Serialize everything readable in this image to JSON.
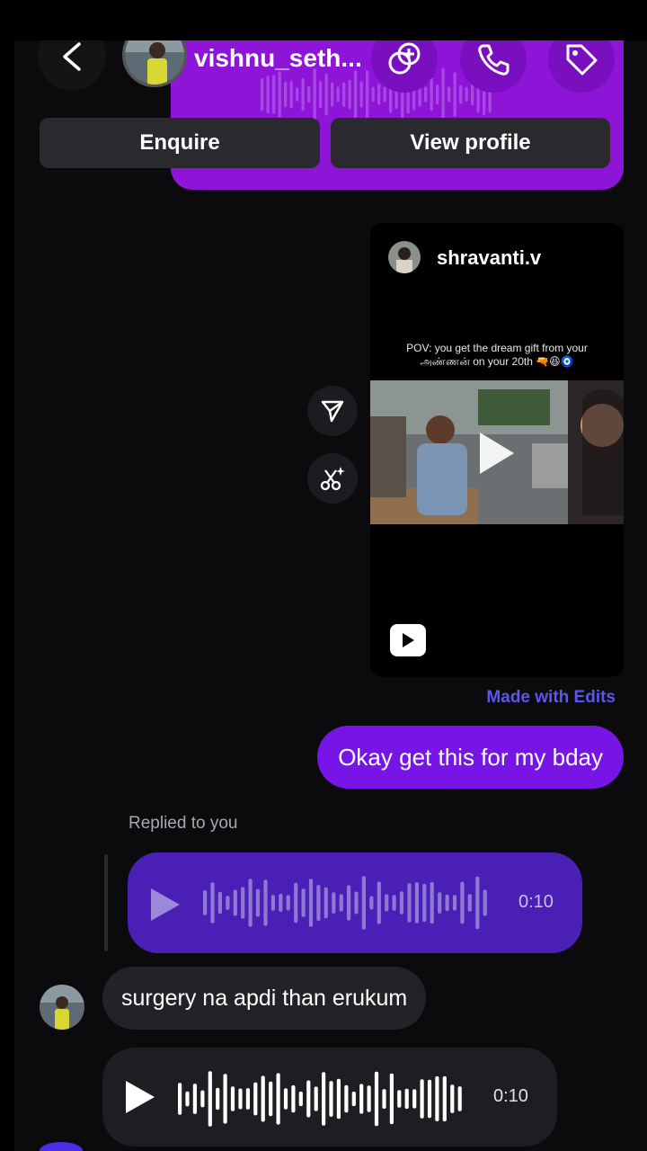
{
  "header": {
    "username": "vishnu_seth...",
    "enquire_label": "Enquire",
    "view_profile_label": "View profile",
    "back_icon": "chevron-left-icon",
    "icons": [
      "video-call-icon",
      "phone-icon",
      "tag-icon"
    ]
  },
  "reel": {
    "username": "shravanti.v",
    "caption": "POV: you get the dream gift from your அண்ணன் on your 20th 🔫😆🧿",
    "footer": "Made with Edits"
  },
  "messages": {
    "outgoing_text": "Okay get this for my bday",
    "replied_label": "Replied to you",
    "quoted_voice_duration": "0:10",
    "incoming_text": "surgery na apdi than erukum",
    "incoming_voice_duration": "0:10"
  },
  "colors": {
    "accent_purple": "#7615e6",
    "header_purple": "#8e14d8",
    "link_blue": "#5a56f0",
    "quoted_voice_bg": "#4a1fb6"
  }
}
